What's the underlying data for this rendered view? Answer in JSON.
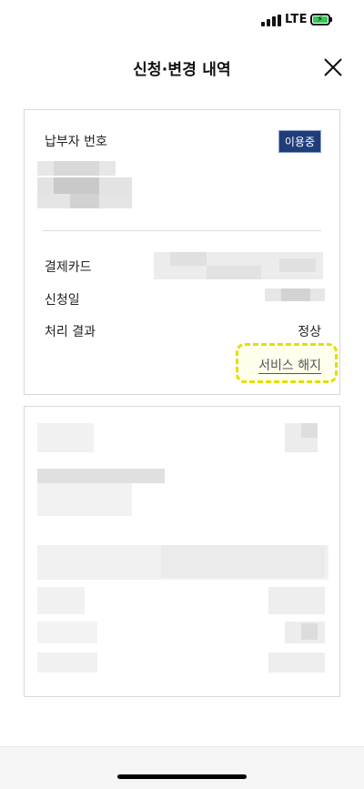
{
  "status_bar": {
    "network": "LTE",
    "signal_icon": "cellular-signal-icon",
    "battery_icon": "battery-charging-icon",
    "battery_color": "#34c759"
  },
  "header": {
    "title": "신청·변경 내역",
    "close_icon": "close-icon"
  },
  "card1": {
    "payer_label": "납부자 번호",
    "status_badge": "이용중",
    "badge_color": "#1f3d7a",
    "card_label": "결제카드",
    "date_label": "신청일",
    "result_label": "처리 결과",
    "result_value": "정상",
    "cancel_label": "서비스 해지",
    "highlight_color": "#e3df00"
  }
}
